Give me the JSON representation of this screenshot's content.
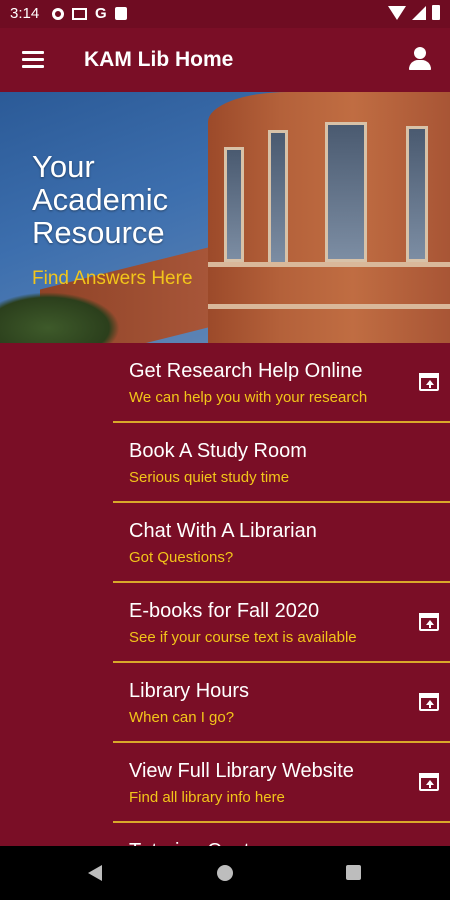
{
  "status_bar": {
    "time": "3:14"
  },
  "app_bar": {
    "title": "KAM Lib Home"
  },
  "hero": {
    "title_lines": [
      "Your",
      "Academic",
      "Resource"
    ],
    "subtitle": "Find Answers Here"
  },
  "items": [
    {
      "title": "Get Research Help Online",
      "subtitle": "We can help you with your research",
      "external": true
    },
    {
      "title": "Book A Study Room",
      "subtitle": "Serious quiet study time",
      "external": false
    },
    {
      "title": "Chat With A Librarian",
      "subtitle": "Got Questions?",
      "external": false
    },
    {
      "title": "E-books for Fall 2020",
      "subtitle": "See if your course text is available",
      "external": true
    },
    {
      "title": "Library Hours",
      "subtitle": "When can I go?",
      "external": true
    },
    {
      "title": "View Full Library Website",
      "subtitle": "Find all library info here",
      "external": true
    }
  ],
  "partial_item": {
    "title": "Tutoring Center"
  },
  "colors": {
    "primary": "#7a0e26",
    "accent": "#f2c51a",
    "divider": "#d9a92a"
  }
}
